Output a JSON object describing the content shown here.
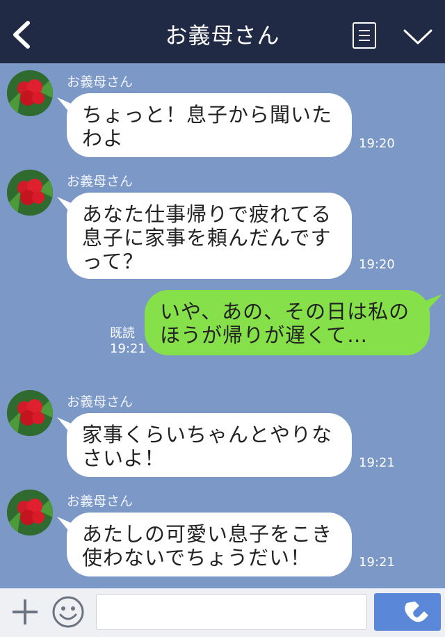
{
  "header": {
    "title": "お義母さん",
    "back_icon": "chevron-left-icon",
    "menu_icon": "notes-icon",
    "expand_icon": "chevron-down-icon"
  },
  "messages": [
    {
      "sender": "お義母さん",
      "text": "ちょっと！息子から聞いたわよ",
      "time": "19:20"
    },
    {
      "sender": "お義母さん",
      "text": "あなた仕事帰りで疲れてる息子に家事を頼んだんですって？",
      "time": "19:20"
    },
    {
      "text": "いや、あの、その日は私のほうが帰りが遅くて…",
      "read": "既読",
      "time": "19:21"
    },
    {
      "sender": "お義母さん",
      "text": "家事くらいちゃんとやりなさいよ！",
      "time": "19:21"
    },
    {
      "sender": "お義母さん",
      "text": "あたしの可愛い息子をこき使わないでちょうだい！",
      "time": "19:21"
    }
  ],
  "footer": {
    "add_icon": "plus-icon",
    "emoji_icon": "smiley-icon",
    "input_placeholder": "",
    "call_icon": "phone-icon"
  },
  "colors": {
    "header_bg": "#212a44",
    "chat_bg": "#7b98c6",
    "incoming_bubble": "#ffffff",
    "outgoing_bubble": "#86e04a",
    "call_button": "#5b87d9"
  }
}
